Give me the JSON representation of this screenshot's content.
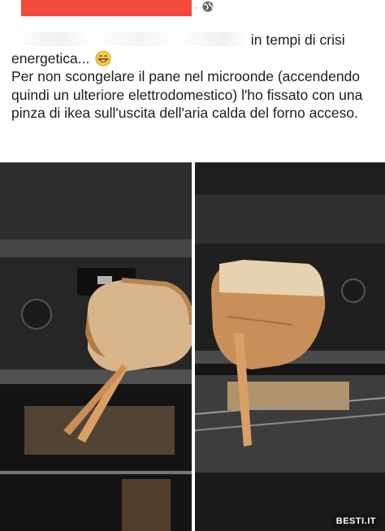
{
  "post": {
    "text_line_1": "in tempi di crisi",
    "text_line_2": "energetica...",
    "emoji": "grinning-face-emoji",
    "text_body": "Per non scongelare il pane nel microonde (accendendo quindi un ulteriore elettrodomestico) l'ho fissato con una pinza di ikea sull'uscita dell'aria calda del forno acceso."
  },
  "header": {
    "separator": "·",
    "privacy_icon": "globe-icon"
  },
  "photos": {
    "left_icon": "oven-with-bread-photo",
    "right_icon": "oven-with-bread-photo"
  },
  "watermark": "BESTI.IT",
  "colors": {
    "redaction": "#f24b3c",
    "text": "#1c1e21",
    "oven": "#2b2b2b"
  }
}
